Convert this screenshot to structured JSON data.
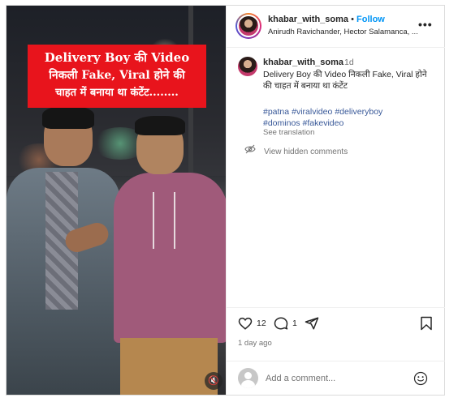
{
  "media": {
    "caption_line1": "Delivery Boy की Video",
    "caption_line2": "निकली Fake, Viral होने की",
    "caption_line3": "चाहत में बनाया था कंटेंट........",
    "mute_icon": "speaker-muted-icon"
  },
  "header": {
    "username": "khabar_with_soma",
    "separator": "•",
    "follow_label": "Follow",
    "audio_text": "Anirudh Ravichander, Hector Salamanca, ...",
    "more_icon": "more-horizontal-icon"
  },
  "caption": {
    "username": "khabar_with_soma",
    "time": "1d",
    "text": "Delivery Boy की Video निकली Fake, Viral होने की चाहत में बनाया था कंटेंट",
    "hashtags": [
      "#patna",
      "#viralvideo",
      "#deliveryboy",
      "#dominos",
      "#fakevideo"
    ],
    "see_translation": "See translation"
  },
  "hidden_comments": {
    "label": "View hidden comments",
    "icon": "eye-off-icon"
  },
  "actions": {
    "like_count": "12",
    "comment_count": "1",
    "posted": "1 day ago",
    "icons": [
      "heart-icon",
      "comment-icon",
      "share-icon",
      "save-icon"
    ]
  },
  "add_comment": {
    "placeholder": "Add a comment...",
    "emoji_icon": "emoji-icon"
  },
  "colors": {
    "follow": "#0095f6",
    "caption_bg": "#e8141c",
    "hashtag": "#385898",
    "muted_text": "#737373"
  }
}
